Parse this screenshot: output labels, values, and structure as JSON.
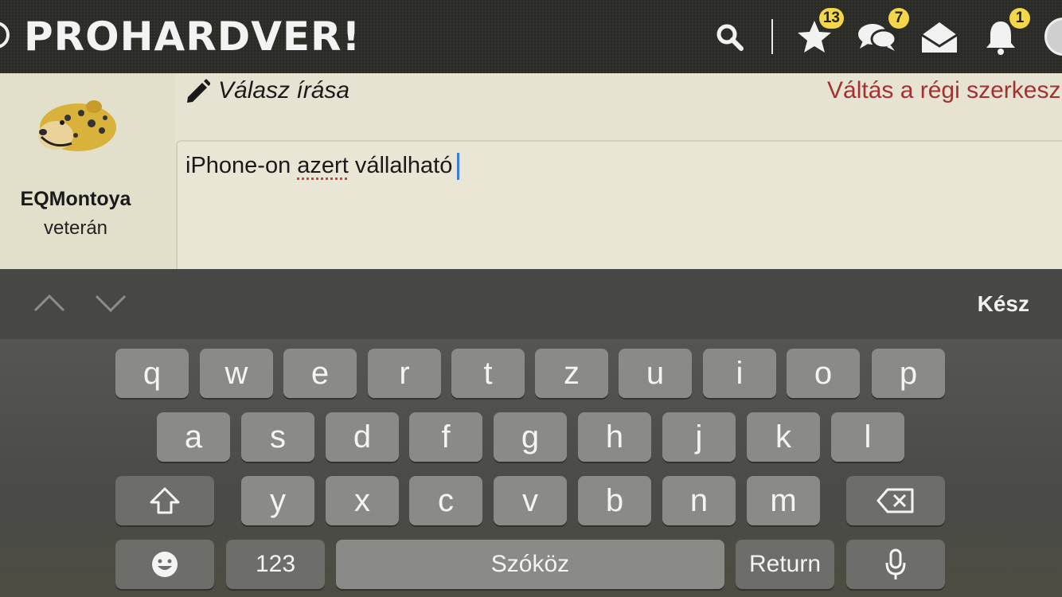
{
  "header": {
    "logo": "PROHARDVER!",
    "favorites_count": "13",
    "messages_count": "7",
    "notifications_count": "1"
  },
  "author": {
    "name": "EQMontoya",
    "rank": "veterán"
  },
  "reply": {
    "title": "Válasz írása",
    "switch_editor": "Váltás a régi szerkesz",
    "text_before": "iPhone-on ",
    "misspelled": "azert",
    "text_after": " vállalható"
  },
  "accessory": {
    "done_label": "Kész"
  },
  "keyboard": {
    "row1": [
      "q",
      "w",
      "e",
      "r",
      "t",
      "z",
      "u",
      "i",
      "o",
      "p"
    ],
    "row2": [
      "a",
      "s",
      "d",
      "f",
      "g",
      "h",
      "j",
      "k",
      "l"
    ],
    "row3": [
      "y",
      "x",
      "c",
      "v",
      "b",
      "n",
      "m"
    ],
    "numbers_label": "123",
    "space_label": "Szóköz",
    "return_label": "Return"
  },
  "colors": {
    "header_bg": "#2b2b28",
    "badge": "#f4d64a",
    "link": "#a33131",
    "caret": "#3b7bdb"
  }
}
